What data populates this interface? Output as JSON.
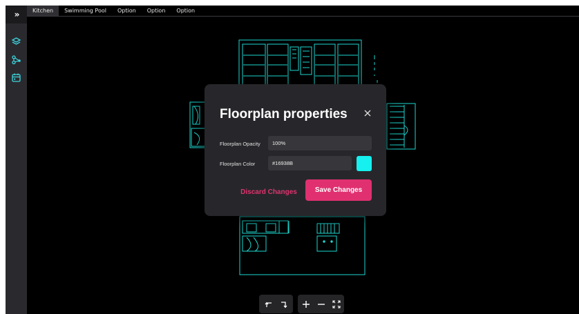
{
  "rail": {
    "toggle_label": "»",
    "icons": [
      "layers-icon",
      "nodes-icon",
      "calendar-icon"
    ]
  },
  "tabs": [
    {
      "label": "Kitchen",
      "active": true
    },
    {
      "label": "Swimming Pool",
      "active": false
    },
    {
      "label": "Option",
      "active": false
    },
    {
      "label": "Option",
      "active": false
    },
    {
      "label": "Option",
      "active": false
    }
  ],
  "dialog": {
    "title": "Floorplan properties",
    "opacity_label": "Floorplan Opacity",
    "opacity_value": "100%",
    "color_label": "Floorplan Color",
    "color_value": "#16938B",
    "swatch_color": "#16f0ee",
    "discard_label": "Discard Changes",
    "save_label": "Save Changes"
  },
  "controls": {
    "undo_icon": "undo-icon",
    "redo_icon": "redo-icon",
    "zoom_in_icon": "zoom-in-icon",
    "zoom_out_icon": "zoom-out-icon",
    "fit_icon": "fit-screen-icon"
  },
  "colors": {
    "plan_stroke": "#1dd8d2",
    "accent": "#e0306f",
    "panel": "#27272b"
  }
}
